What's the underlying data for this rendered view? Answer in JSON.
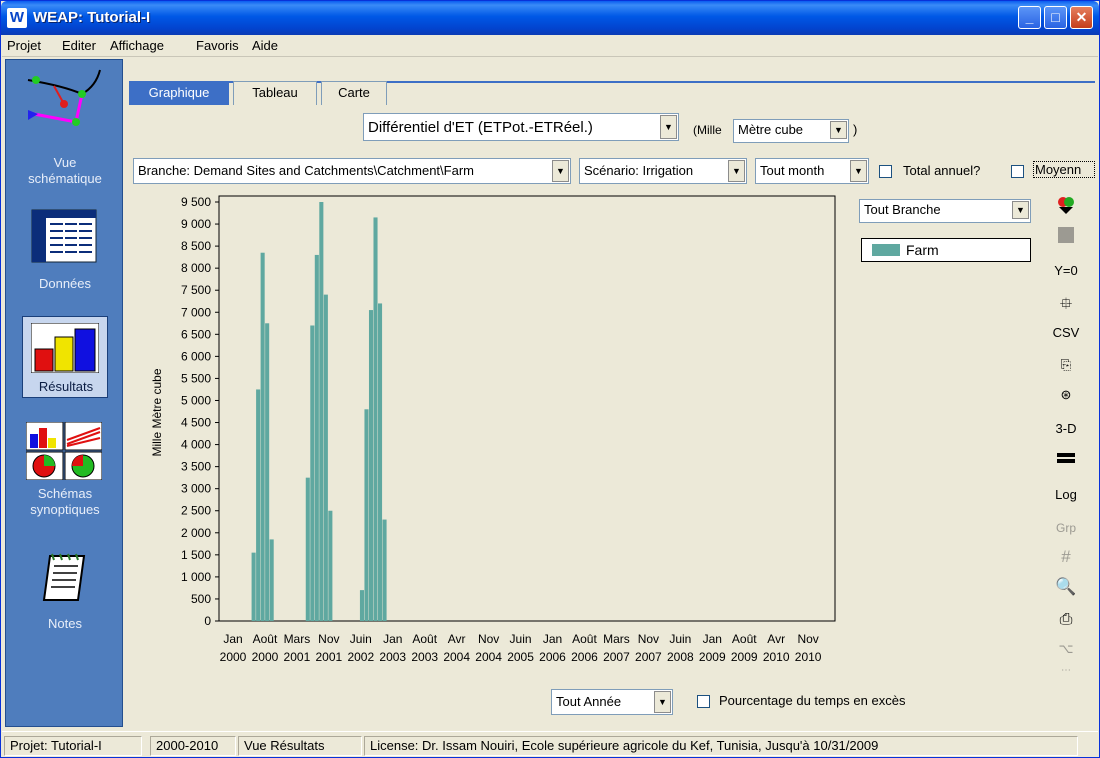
{
  "window": {
    "title": "WEAP: Tutorial-I",
    "icon_letter": "W",
    "min": "_",
    "max": "□",
    "close": "✕"
  },
  "menu": [
    "Projet",
    "Editer",
    "Affichage",
    "Favoris",
    "Aide"
  ],
  "sidebar": {
    "items": [
      {
        "label1": "Vue",
        "label2": "schématique"
      },
      {
        "label1": "Données",
        "label2": ""
      },
      {
        "label1": "Résultats",
        "label2": ""
      },
      {
        "label1": "Schémas",
        "label2": "synoptiques"
      },
      {
        "label1": "Notes",
        "label2": ""
      }
    ]
  },
  "tabs": [
    "Graphique",
    "Tableau",
    "Carte"
  ],
  "variable": {
    "selected": "Différentiel d'ET (ETPot.-ETRéel.)",
    "unit_prefix": "(Mille",
    "unit": "Mètre cube",
    "unit_suffix": ")"
  },
  "filters": {
    "branch": "Branche: Demand Sites and Catchments\\Catchment\\Farm",
    "scenario": "Scénario: Irrigation",
    "month": "Tout month",
    "annual_total_label": "Total annuel?",
    "average_label": "Moyenn"
  },
  "legend": {
    "dropdown": "Tout Branche",
    "item": "Farm",
    "color": "#5fa8a0"
  },
  "right_toolbar": [
    "color-icon",
    "square-icon",
    "Y=0",
    "stack-icon",
    "CSV",
    "copy-icon",
    "disc-icon",
    "3-D",
    "line-icon",
    "Log",
    "Grp",
    "grid-icon",
    "zoom-icon",
    "print-icon",
    "broom-icon",
    "more-icon"
  ],
  "bottom": {
    "year_select": "Tout Année",
    "exceedance_label": "Pourcentage du temps en excès"
  },
  "status": {
    "project": "Projet: Tutorial-I",
    "years": "2000-2010",
    "view": "Vue Résultats",
    "license": "License: Dr. Issam Nouiri, Ecole supérieure agricole du Kef, Tunisia, Jusqu'à 10/31/2009"
  },
  "chart_data": {
    "type": "bar",
    "ylabel": "Mille Mètre cube",
    "ylim": [
      0,
      9500
    ],
    "yticks": [
      "9 500",
      "9 000",
      "8 500",
      "8 000",
      "7 500",
      "7 000",
      "6 500",
      "6 000",
      "5 500",
      "5 000",
      "4 500",
      "4 000",
      "3 500",
      "3 000",
      "2 500",
      "2 000",
      "1 500",
      "1 000",
      "500",
      "0"
    ],
    "xticks": [
      [
        "Jan",
        "2000"
      ],
      [
        "Août",
        "2000"
      ],
      [
        "Mars",
        "2001"
      ],
      [
        "Nov",
        "2001"
      ],
      [
        "Juin",
        "2002"
      ],
      [
        "Jan",
        "2003"
      ],
      [
        "Août",
        "2003"
      ],
      [
        "Avr",
        "2004"
      ],
      [
        "Nov",
        "2004"
      ],
      [
        "Juin",
        "2005"
      ],
      [
        "Jan",
        "2006"
      ],
      [
        "Août",
        "2006"
      ],
      [
        "Mars",
        "2007"
      ],
      [
        "Nov",
        "2007"
      ],
      [
        "Juin",
        "2008"
      ],
      [
        "Jan",
        "2009"
      ],
      [
        "Août",
        "2009"
      ],
      [
        "Avr",
        "2010"
      ],
      [
        "Nov",
        "2010"
      ]
    ],
    "series": [
      {
        "name": "Farm",
        "color": "#5fa8a0",
        "bars": [
          {
            "month": 5,
            "value": 1550
          },
          {
            "month": 6,
            "value": 5250
          },
          {
            "month": 7,
            "value": 8350
          },
          {
            "month": 8,
            "value": 6750
          },
          {
            "month": 9,
            "value": 1850
          },
          {
            "month": 17,
            "value": 3250
          },
          {
            "month": 18,
            "value": 6700
          },
          {
            "month": 19,
            "value": 8300
          },
          {
            "month": 20,
            "value": 9500
          },
          {
            "month": 21,
            "value": 7400
          },
          {
            "month": 22,
            "value": 2500
          },
          {
            "month": 29,
            "value": 700
          },
          {
            "month": 30,
            "value": 4800
          },
          {
            "month": 31,
            "value": 7050
          },
          {
            "month": 32,
            "value": 9150
          },
          {
            "month": 33,
            "value": 7200
          },
          {
            "month": 34,
            "value": 2300
          }
        ]
      }
    ],
    "months_total": 132
  }
}
